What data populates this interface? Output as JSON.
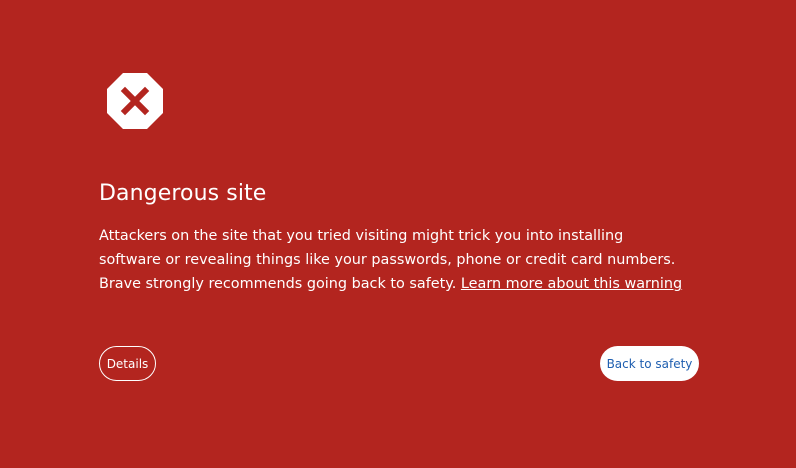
{
  "icon": {
    "name": "stop-x-icon",
    "color": "#b3251f"
  },
  "title": "Dangerous site",
  "message": {
    "text": "Attackers on the site that you tried visiting might trick you into installing software or revealing things like your passwords, phone or credit card numbers. Brave strongly recommends going back to safety.",
    "link_label": "Learn more about this warning"
  },
  "buttons": {
    "details_label": "Details",
    "back_label": "Back to safety"
  },
  "colors": {
    "background": "#b3251f",
    "primary_button_text": "#1f5fb0"
  }
}
